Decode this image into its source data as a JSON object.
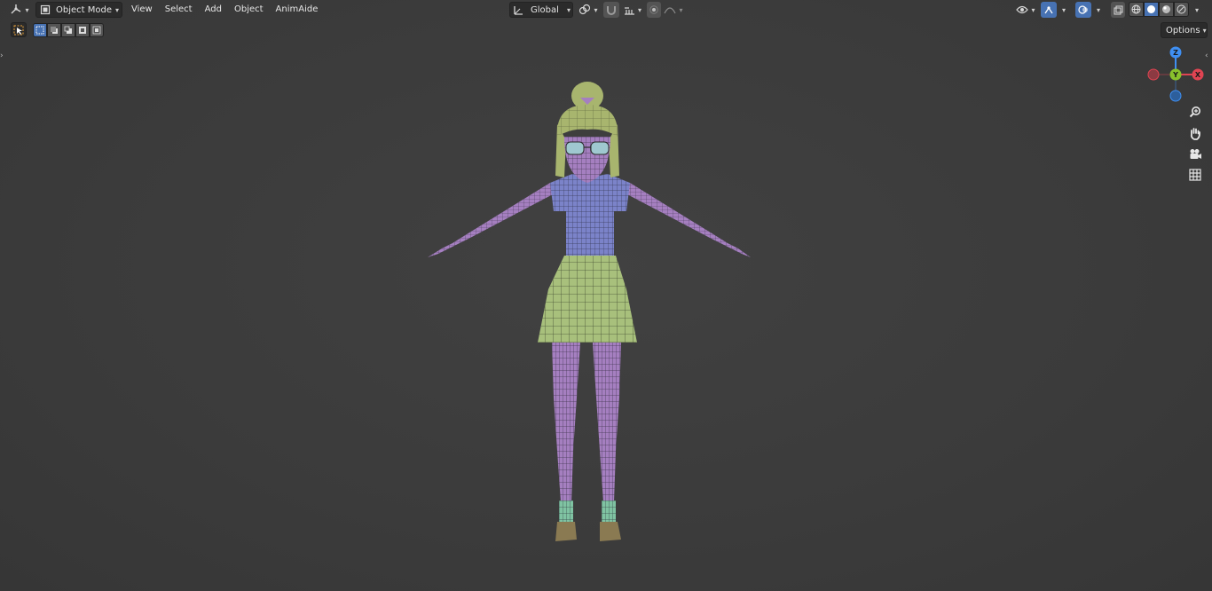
{
  "header": {
    "editor_type_icon": "3d-viewport-icon",
    "mode_icon": "object-mode-icon",
    "mode_label": "Object Mode",
    "menus": [
      "View",
      "Select",
      "Add",
      "Object",
      "AnimAide"
    ],
    "orientation_label": "Global",
    "options_label": "Options"
  },
  "toolbar": {
    "select_tool_icon": "select-box-icon",
    "select_modes": [
      "select-new-icon",
      "select-extend-icon",
      "select-subtract-icon",
      "select-invert-icon",
      "select-intersect-icon"
    ]
  },
  "gizmo": {
    "axes": {
      "z": "Z",
      "y": "Y",
      "x": "X"
    },
    "colors": {
      "x": "#e04452",
      "y": "#88c02c",
      "z": "#3f8ff2"
    }
  },
  "nav_buttons": [
    "zoom-icon",
    "hand-pan-icon",
    "camera-icon",
    "grid-ortho-icon"
  ],
  "viewport": {
    "background": "#3d3d3d",
    "accent": "#4772b3",
    "model_colors": {
      "skin": "#a57fc0",
      "shirt": "#7b83c9",
      "skirt": "#a8c07c",
      "hair": "#a8b56e",
      "socks": "#7fc3a2"
    }
  }
}
